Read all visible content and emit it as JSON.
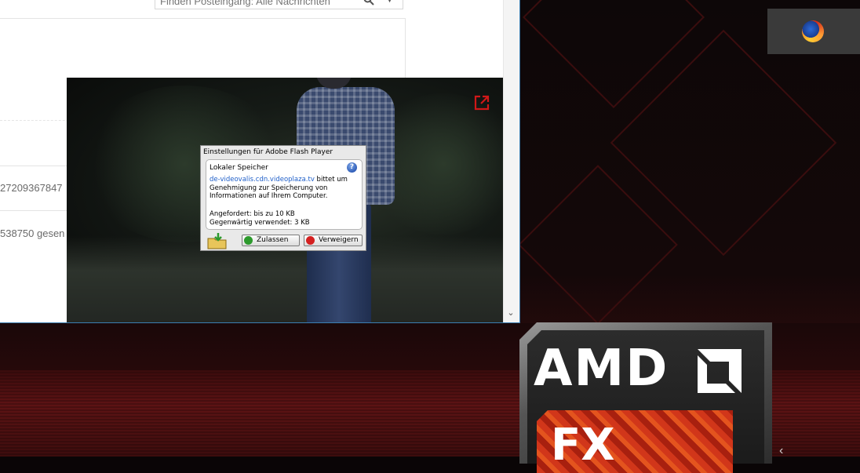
{
  "browser": {
    "search": {
      "placeholder": "Finden Posteingang: Alle Nachrichten"
    },
    "rows": [
      {
        "text": "27209367847"
      },
      {
        "text": "538750 gesen"
      }
    ]
  },
  "flash_dialog": {
    "title": "Einstellungen für Adobe Flash Player",
    "heading": "Lokaler Speicher",
    "help_icon": "?",
    "domain": "de-videovalis.cdn.videoplaza.tv",
    "message": " bittet um Genehmigung zur Speicherung von Informationen auf Ihrem Computer.",
    "requested": "Angefordert: bis zu 10 KB",
    "current": "Gegenwärtig verwendet: 3 KB",
    "allow_label": "Zulassen",
    "deny_label": "Verweigern"
  },
  "amd": {
    "logo_text": "AMD",
    "sub_text": "FX"
  },
  "colors": {
    "accent_blue": "#3c7fb1",
    "link": "#1f5fc9",
    "allow": "#2d9a2d",
    "deny": "#d42020",
    "amd_red": "#d1361a"
  }
}
